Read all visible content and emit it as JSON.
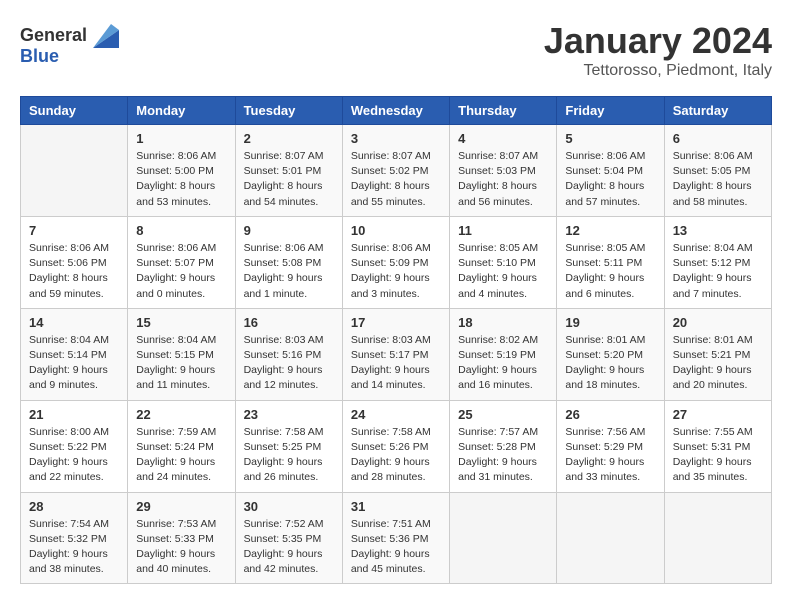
{
  "logo": {
    "general": "General",
    "blue": "Blue"
  },
  "title": "January 2024",
  "location": "Tettorosso, Piedmont, Italy",
  "weekdays": [
    "Sunday",
    "Monday",
    "Tuesday",
    "Wednesday",
    "Thursday",
    "Friday",
    "Saturday"
  ],
  "weeks": [
    [
      {
        "day": "",
        "info": ""
      },
      {
        "day": "1",
        "info": "Sunrise: 8:06 AM\nSunset: 5:00 PM\nDaylight: 8 hours\nand 53 minutes."
      },
      {
        "day": "2",
        "info": "Sunrise: 8:07 AM\nSunset: 5:01 PM\nDaylight: 8 hours\nand 54 minutes."
      },
      {
        "day": "3",
        "info": "Sunrise: 8:07 AM\nSunset: 5:02 PM\nDaylight: 8 hours\nand 55 minutes."
      },
      {
        "day": "4",
        "info": "Sunrise: 8:07 AM\nSunset: 5:03 PM\nDaylight: 8 hours\nand 56 minutes."
      },
      {
        "day": "5",
        "info": "Sunrise: 8:06 AM\nSunset: 5:04 PM\nDaylight: 8 hours\nand 57 minutes."
      },
      {
        "day": "6",
        "info": "Sunrise: 8:06 AM\nSunset: 5:05 PM\nDaylight: 8 hours\nand 58 minutes."
      }
    ],
    [
      {
        "day": "7",
        "info": "Sunrise: 8:06 AM\nSunset: 5:06 PM\nDaylight: 8 hours\nand 59 minutes."
      },
      {
        "day": "8",
        "info": "Sunrise: 8:06 AM\nSunset: 5:07 PM\nDaylight: 9 hours\nand 0 minutes."
      },
      {
        "day": "9",
        "info": "Sunrise: 8:06 AM\nSunset: 5:08 PM\nDaylight: 9 hours\nand 1 minute."
      },
      {
        "day": "10",
        "info": "Sunrise: 8:06 AM\nSunset: 5:09 PM\nDaylight: 9 hours\nand 3 minutes."
      },
      {
        "day": "11",
        "info": "Sunrise: 8:05 AM\nSunset: 5:10 PM\nDaylight: 9 hours\nand 4 minutes."
      },
      {
        "day": "12",
        "info": "Sunrise: 8:05 AM\nSunset: 5:11 PM\nDaylight: 9 hours\nand 6 minutes."
      },
      {
        "day": "13",
        "info": "Sunrise: 8:04 AM\nSunset: 5:12 PM\nDaylight: 9 hours\nand 7 minutes."
      }
    ],
    [
      {
        "day": "14",
        "info": "Sunrise: 8:04 AM\nSunset: 5:14 PM\nDaylight: 9 hours\nand 9 minutes."
      },
      {
        "day": "15",
        "info": "Sunrise: 8:04 AM\nSunset: 5:15 PM\nDaylight: 9 hours\nand 11 minutes."
      },
      {
        "day": "16",
        "info": "Sunrise: 8:03 AM\nSunset: 5:16 PM\nDaylight: 9 hours\nand 12 minutes."
      },
      {
        "day": "17",
        "info": "Sunrise: 8:03 AM\nSunset: 5:17 PM\nDaylight: 9 hours\nand 14 minutes."
      },
      {
        "day": "18",
        "info": "Sunrise: 8:02 AM\nSunset: 5:19 PM\nDaylight: 9 hours\nand 16 minutes."
      },
      {
        "day": "19",
        "info": "Sunrise: 8:01 AM\nSunset: 5:20 PM\nDaylight: 9 hours\nand 18 minutes."
      },
      {
        "day": "20",
        "info": "Sunrise: 8:01 AM\nSunset: 5:21 PM\nDaylight: 9 hours\nand 20 minutes."
      }
    ],
    [
      {
        "day": "21",
        "info": "Sunrise: 8:00 AM\nSunset: 5:22 PM\nDaylight: 9 hours\nand 22 minutes."
      },
      {
        "day": "22",
        "info": "Sunrise: 7:59 AM\nSunset: 5:24 PM\nDaylight: 9 hours\nand 24 minutes."
      },
      {
        "day": "23",
        "info": "Sunrise: 7:58 AM\nSunset: 5:25 PM\nDaylight: 9 hours\nand 26 minutes."
      },
      {
        "day": "24",
        "info": "Sunrise: 7:58 AM\nSunset: 5:26 PM\nDaylight: 9 hours\nand 28 minutes."
      },
      {
        "day": "25",
        "info": "Sunrise: 7:57 AM\nSunset: 5:28 PM\nDaylight: 9 hours\nand 31 minutes."
      },
      {
        "day": "26",
        "info": "Sunrise: 7:56 AM\nSunset: 5:29 PM\nDaylight: 9 hours\nand 33 minutes."
      },
      {
        "day": "27",
        "info": "Sunrise: 7:55 AM\nSunset: 5:31 PM\nDaylight: 9 hours\nand 35 minutes."
      }
    ],
    [
      {
        "day": "28",
        "info": "Sunrise: 7:54 AM\nSunset: 5:32 PM\nDaylight: 9 hours\nand 38 minutes."
      },
      {
        "day": "29",
        "info": "Sunrise: 7:53 AM\nSunset: 5:33 PM\nDaylight: 9 hours\nand 40 minutes."
      },
      {
        "day": "30",
        "info": "Sunrise: 7:52 AM\nSunset: 5:35 PM\nDaylight: 9 hours\nand 42 minutes."
      },
      {
        "day": "31",
        "info": "Sunrise: 7:51 AM\nSunset: 5:36 PM\nDaylight: 9 hours\nand 45 minutes."
      },
      {
        "day": "",
        "info": ""
      },
      {
        "day": "",
        "info": ""
      },
      {
        "day": "",
        "info": ""
      }
    ]
  ]
}
